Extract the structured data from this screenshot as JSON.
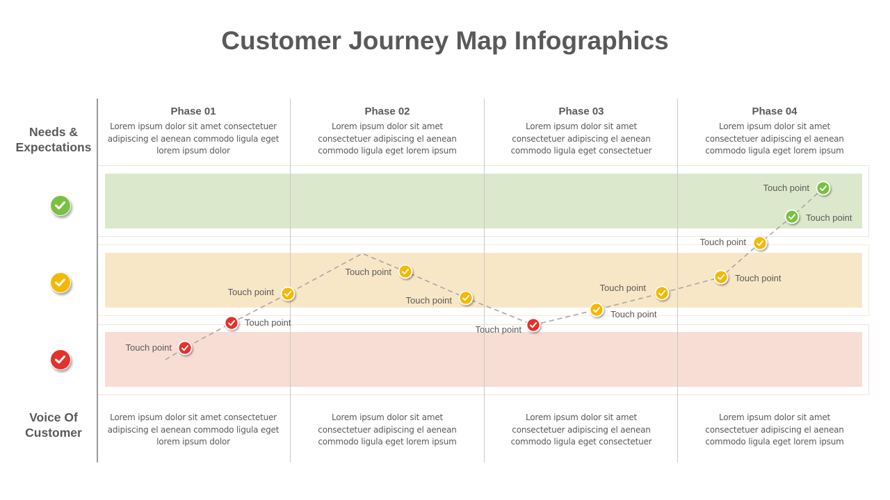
{
  "title": "Customer Journey Map Infographics",
  "rows": {
    "needs_label": "Needs & Expectations",
    "voice_label": "Voice Of Customer"
  },
  "phases": [
    {
      "title": "Phase 01",
      "needs": "Lorem ipsum dolor sit amet consectetuer adipiscing el aenean commodo ligula eget lorem ipsum dolor",
      "voice": "Lorem ipsum dolor sit amet consectetuer adipiscing el aenean commodo ligula eget lorem ipsum dolor"
    },
    {
      "title": "Phase 02",
      "needs": "Lorem ipsum dolor sit amet consectetuer adipiscing el aenean commodo ligula eget lorem ipsum",
      "voice": "Lorem ipsum dolor sit amet consectetuer adipiscing el aenean commodo ligula eget lorem ipsum"
    },
    {
      "title": "Phase 03",
      "needs": "Lorem ipsum dolor sit amet consectetuer adipiscing el aenean commodo ligula eget consectetuer",
      "voice": "Lorem ipsum dolor sit amet consectetuer adipiscing el aenean commodo ligula eget consectetuer"
    },
    {
      "title": "Phase 04",
      "needs": "Lorem ipsum dolor sit amet consectetuer adipiscing el aenean commodo ligula eget lorem ipsum",
      "voice": "Lorem ipsum dolor sit amet consectetuer adipiscing el aenean commodo ligula eget lorem ipsum"
    }
  ],
  "levels": [
    {
      "name": "positive",
      "icon": "check-icon",
      "color": "#7ac143",
      "band_color": "#dce8cb",
      "frame_color": "#e6ead9"
    },
    {
      "name": "neutral",
      "icon": "check-icon",
      "color": "#f5b800",
      "band_color": "#f8e7c7",
      "frame_color": "#f6ecd6"
    },
    {
      "name": "negative",
      "icon": "check-icon",
      "color": "#e3322b",
      "band_color": "#f8ddd5",
      "frame_color": "#f6e0da"
    }
  ],
  "line_color": "#a6a6a6",
  "touch_points": [
    {
      "label": "Touch point",
      "level": "negative",
      "phase": 1
    },
    {
      "label": "Touch point",
      "level": "negative",
      "phase": 1
    },
    {
      "label": "Touch point",
      "level": "neutral",
      "phase": 1
    },
    {
      "label": "Touch point",
      "level": "neutral",
      "phase": 2
    },
    {
      "label": "Touch point",
      "level": "neutral",
      "phase": 2
    },
    {
      "label": "Touch point",
      "level": "negative",
      "phase": 3
    },
    {
      "label": "Touch point",
      "level": "neutral",
      "phase": 3
    },
    {
      "label": "Touch point",
      "level": "neutral",
      "phase": 3
    },
    {
      "label": "Touch point",
      "level": "neutral",
      "phase": 4
    },
    {
      "label": "Touch point",
      "level": "neutral",
      "phase": 4
    },
    {
      "label": "Touch point",
      "level": "positive",
      "phase": 4
    },
    {
      "label": "Touch point",
      "level": "positive",
      "phase": 4
    }
  ]
}
